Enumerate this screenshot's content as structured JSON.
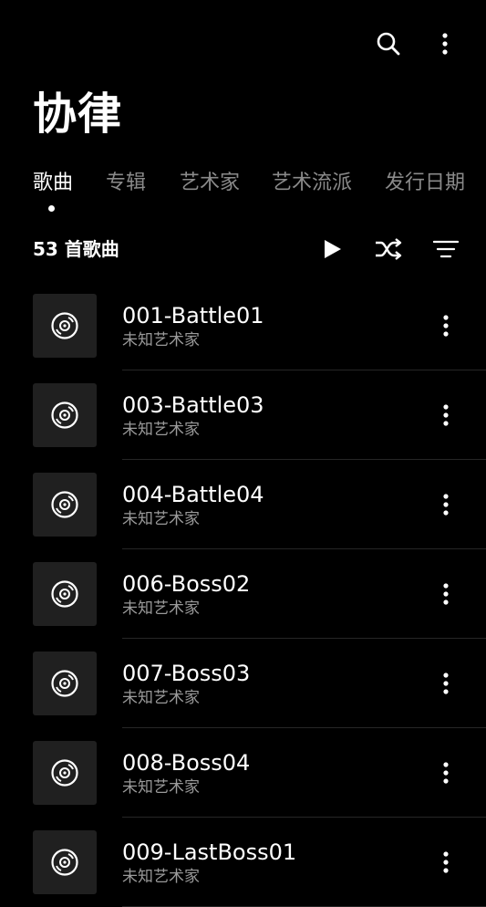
{
  "header": {
    "title": "协律",
    "search_icon": "search-icon",
    "more_icon": "more-vertical-icon"
  },
  "tabs": [
    {
      "label": "歌曲",
      "active": true
    },
    {
      "label": "专辑",
      "active": false
    },
    {
      "label": "艺术家",
      "active": false
    },
    {
      "label": "艺术流派",
      "active": false
    },
    {
      "label": "发行日期",
      "active": false
    }
  ],
  "summary": {
    "count_label": "53 首歌曲",
    "play_icon": "play-icon",
    "shuffle_icon": "shuffle-icon",
    "sort_icon": "sort-icon"
  },
  "songs": [
    {
      "title": "001-Battle01",
      "artist": "未知艺术家"
    },
    {
      "title": "003-Battle03",
      "artist": "未知艺术家"
    },
    {
      "title": "004-Battle04",
      "artist": "未知艺术家"
    },
    {
      "title": "006-Boss02",
      "artist": "未知艺术家"
    },
    {
      "title": "007-Boss03",
      "artist": "未知艺术家"
    },
    {
      "title": "008-Boss04",
      "artist": "未知艺术家"
    },
    {
      "title": "009-LastBoss01",
      "artist": "未知艺术家"
    }
  ],
  "colors": {
    "background": "#000000",
    "text": "#ffffff",
    "secondary_text": "#9a9a9a",
    "inactive_tab": "#8a8a8a",
    "thumb_bg": "#202020"
  }
}
